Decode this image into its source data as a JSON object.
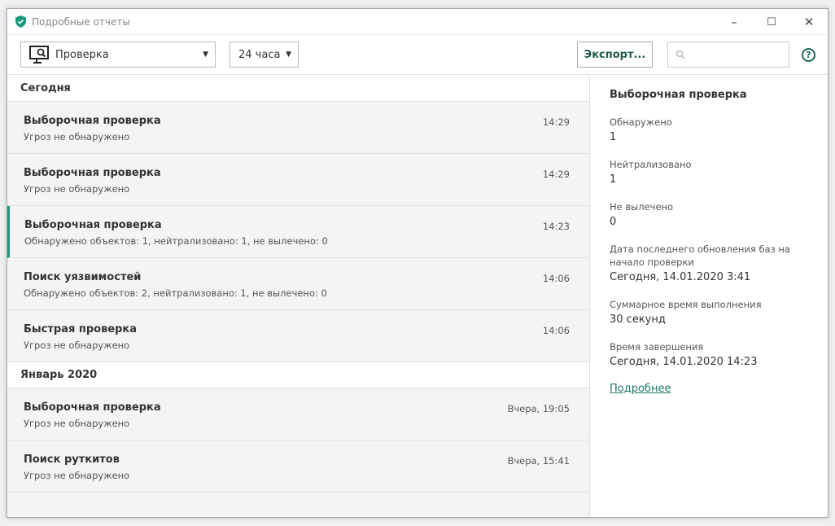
{
  "window": {
    "title": "Подробные отчеты",
    "minimize": "–",
    "maximize": "☐",
    "close": "✕"
  },
  "toolbar": {
    "category": "Проверка",
    "period": "24 часа",
    "export": "Экспорт...",
    "search_placeholder": "",
    "help": "?"
  },
  "groups": [
    {
      "label": "Сегодня",
      "items": [
        {
          "title": "Выборочная проверка",
          "subtitle": "Угроз не обнаружено",
          "time": "14:29"
        },
        {
          "title": "Выборочная проверка",
          "subtitle": "Угроз не обнаружено",
          "time": "14:29"
        },
        {
          "title": "Выборочная проверка",
          "subtitle": "Обнаружено объектов: 1, нейтрализовано: 1, не вылечено: 0",
          "time": "14:23"
        },
        {
          "title": "Поиск уязвимостей",
          "subtitle": "Обнаружено объектов: 2, нейтрализовано: 1, не вылечено: 0",
          "time": "14:06"
        },
        {
          "title": "Быстрая проверка",
          "subtitle": "Угроз не обнаружено",
          "time": "14:06"
        }
      ]
    },
    {
      "label": "Январь 2020",
      "items": [
        {
          "title": "Выборочная проверка",
          "subtitle": "Угроз не обнаружено",
          "time": "Вчера, 19:05"
        },
        {
          "title": "Поиск руткитов",
          "subtitle": "Угроз не обнаружено",
          "time": "Вчера, 15:41"
        }
      ]
    }
  ],
  "details": {
    "title": "Выборочная проверка",
    "fields": [
      {
        "label": "Обнаружено",
        "value": "1"
      },
      {
        "label": "Нейтрализовано",
        "value": "1"
      },
      {
        "label": "Не вылечено",
        "value": "0"
      },
      {
        "label": "Дата последнего обновления баз на начало проверки",
        "value": "Сегодня, 14.01.2020 3:41"
      },
      {
        "label": "Суммарное время выполнения",
        "value": "30 секунд"
      },
      {
        "label": "Время завершения",
        "value": "Сегодня, 14.01.2020 14:23"
      }
    ],
    "more": "Подробнее"
  }
}
